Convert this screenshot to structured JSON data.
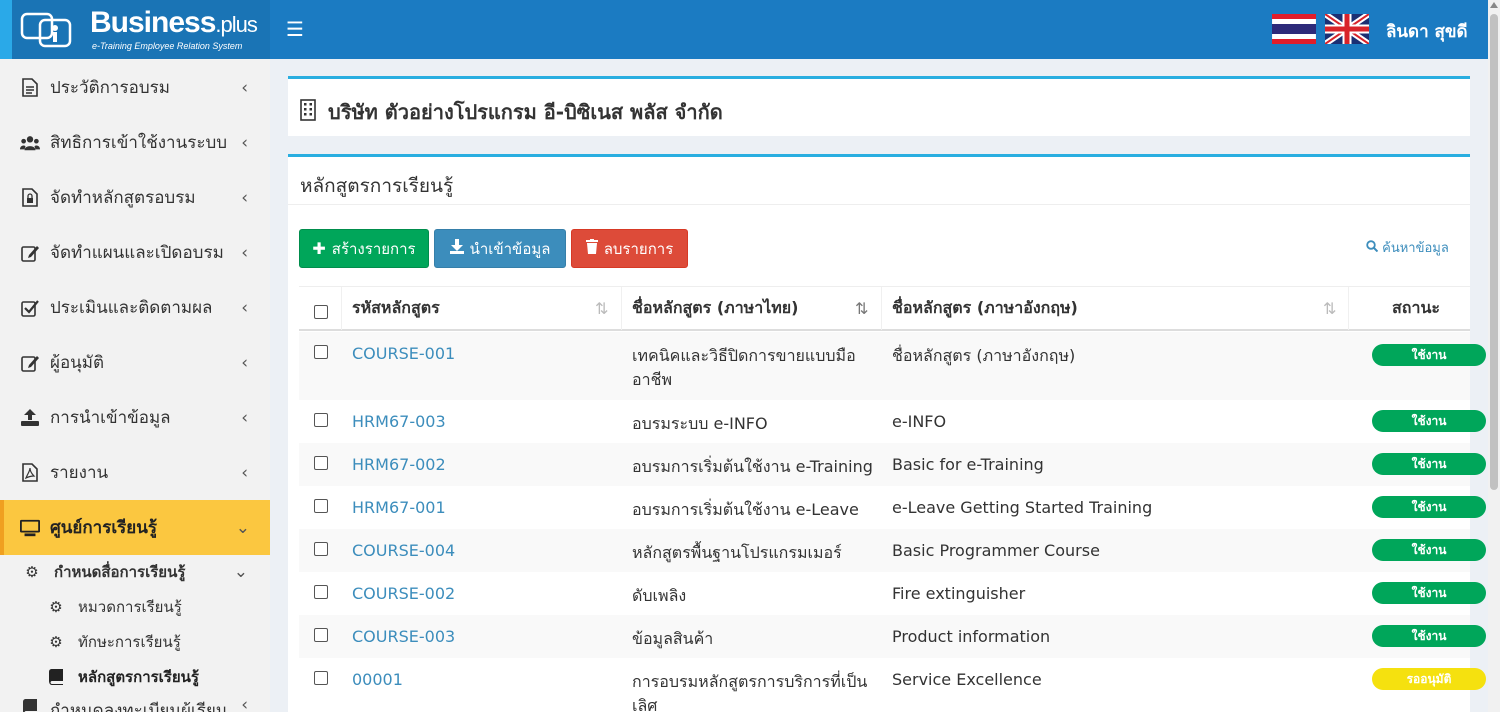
{
  "header": {
    "logo_text": "Business",
    "logo_plus": ".plus",
    "logo_subtitle": "e-Training Employee Relation System",
    "user_name": "ลินดา สุขดี"
  },
  "sidebar": {
    "items": [
      {
        "label": "ประวัติการอบรม",
        "icon": "document-icon"
      },
      {
        "label": "สิทธิการเข้าใช้งานระบบ",
        "icon": "users-icon"
      },
      {
        "label": "จัดทำหลักสูตรอบรม",
        "icon": "file-lock-icon"
      },
      {
        "label": "จัดทำแผนและเปิดอบรม",
        "icon": "edit-icon"
      },
      {
        "label": "ประเมินและติดตามผล",
        "icon": "check-square-icon"
      },
      {
        "label": "ผู้อนุมัติ",
        "icon": "edit-icon"
      },
      {
        "label": "การนำเข้าข้อมูล",
        "icon": "upload-icon"
      },
      {
        "label": "รายงาน",
        "icon": "pdf-icon"
      },
      {
        "label": "ศูนย์การเรียนรู้",
        "icon": "monitor-icon"
      }
    ],
    "sub_group": {
      "label": "กำหนดสื่อการเรียนรู้"
    },
    "sub_items": [
      {
        "label": "หมวดการเรียนรู้"
      },
      {
        "label": "ทักษะการเรียนรู้"
      },
      {
        "label": "หลักสูตรการเรียนรู้"
      }
    ],
    "cut_item": {
      "label": "กำหนดลงทะเบียนผู้เรียน"
    }
  },
  "company": {
    "title": "บริษัท ตัวอย่างโปรแกรม อี-บิซิเนส พลัส จำกัด"
  },
  "main": {
    "title": "หลักสูตรการเรียนรู้",
    "buttons": {
      "create": "สร้างรายการ",
      "import": "นำเข้าข้อมูล",
      "delete": "ลบรายการ"
    },
    "search_label": "ค้นหาข้อมูล",
    "table": {
      "columns": [
        "รหัสหลักสูตร",
        "ชื่อหลักสูตร (ภาษาไทย)",
        "ชื่อหลักสูตร (ภาษาอังกฤษ)",
        "สถานะ"
      ],
      "rows": [
        {
          "code": "COURSE-001",
          "name_th": "เทคนิคและวิธีปิดการขายแบบมือ",
          "name_th_2": "อาชีพ",
          "name_en": "ชื่อหลักสูตร (ภาษาอังกฤษ)",
          "status": "ใช้งาน"
        },
        {
          "code": "HRM67-003",
          "name_th": "อบรมระบบ e-INFO",
          "name_th_2": "",
          "name_en": "e-INFO",
          "status": "ใช้งาน"
        },
        {
          "code": "HRM67-002",
          "name_th": "อบรมการเริ่มต้นใช้งาน e-Training",
          "name_th_2": "",
          "name_en": "Basic for e-Training",
          "status": "ใช้งาน"
        },
        {
          "code": "HRM67-001",
          "name_th": "อบรมการเริ่มต้นใช้งาน e-Leave",
          "name_th_2": "",
          "name_en": "e-Leave Getting Started Training",
          "status": "ใช้งาน"
        },
        {
          "code": "COURSE-004",
          "name_th": "หลักสูตรพื้นฐานโปรแกรมเมอร์",
          "name_th_2": "",
          "name_en": "Basic Programmer Course",
          "status": "ใช้งาน"
        },
        {
          "code": "COURSE-002",
          "name_th": "ดับเพลิง",
          "name_th_2": "",
          "name_en": "Fire extinguisher",
          "status": "ใช้งาน"
        },
        {
          "code": "COURSE-003",
          "name_th": "ข้อมูลสินค้า",
          "name_th_2": "",
          "name_en": "Product information",
          "status": "ใช้งาน"
        },
        {
          "code": "00001",
          "name_th": "การอบรมหลักสูตรการบริการที่เป็น",
          "name_th_2": "เลิศ",
          "name_en": "Service Excellence",
          "status": "รออนุมัติ"
        }
      ]
    }
  },
  "colors": {
    "header": "#1b7bc2",
    "accent": "#29aee0",
    "active_menu": "#fbc740",
    "green": "#00a65a",
    "red": "#dd4b39",
    "blue": "#3c8dbc",
    "yellow": "#f5e10f"
  }
}
